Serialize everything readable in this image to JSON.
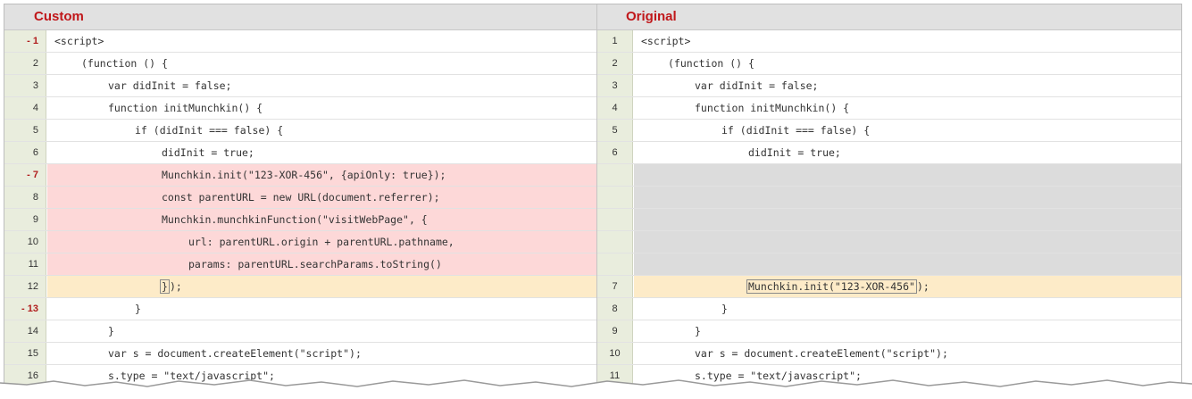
{
  "left_pane": {
    "title": "Custom",
    "lines": [
      {
        "num": "- 1",
        "indent": 0,
        "text": "<script>",
        "status": "changed-marker"
      },
      {
        "num": "2",
        "indent": 1,
        "text": "(function () {"
      },
      {
        "num": "3",
        "indent": 2,
        "text": "var didInit = false;"
      },
      {
        "num": "4",
        "indent": 2,
        "text": "function initMunchkin() {"
      },
      {
        "num": "5",
        "indent": 3,
        "text": "if (didInit === false) {"
      },
      {
        "num": "6",
        "indent": 4,
        "text": "didInit = true;"
      },
      {
        "num": "- 7",
        "indent": 4,
        "text": "Munchkin.init(\"123-XOR-456\", {apiOnly: true});",
        "status": "deleted",
        "marker": true
      },
      {
        "num": "8",
        "indent": 4,
        "text": "const parentURL = new URL(document.referrer);",
        "status": "deleted"
      },
      {
        "num": "9",
        "indent": 4,
        "text": "Munchkin.munchkinFunction(\"visitWebPage\", {",
        "status": "deleted"
      },
      {
        "num": "10",
        "indent": 5,
        "text": "url: parentURL.origin + parentURL.pathname,",
        "status": "deleted"
      },
      {
        "num": "11",
        "indent": 5,
        "text": "params: parentURL.searchParams.toString()",
        "status": "deleted"
      },
      {
        "num": "12",
        "indent": 4,
        "text_hl": "}",
        "text_after": ");",
        "status": "modified"
      },
      {
        "num": "- 13",
        "indent": 3,
        "text": "}",
        "status": "changed-marker"
      },
      {
        "num": "14",
        "indent": 2,
        "text": "}"
      },
      {
        "num": "15",
        "indent": 2,
        "text": "var s = document.createElement(\"script\");"
      },
      {
        "num": "16",
        "indent": 2,
        "text": "s.type = \"text/javascript\";"
      }
    ]
  },
  "right_pane": {
    "title": "Original",
    "lines": [
      {
        "num": "1",
        "indent": 0,
        "text": "<script>"
      },
      {
        "num": "2",
        "indent": 1,
        "text": "(function () {"
      },
      {
        "num": "3",
        "indent": 2,
        "text": "var didInit = false;"
      },
      {
        "num": "4",
        "indent": 2,
        "text": "function initMunchkin() {"
      },
      {
        "num": "5",
        "indent": 3,
        "text": "if (didInit === false) {"
      },
      {
        "num": "6",
        "indent": 4,
        "text": "didInit = true;"
      },
      {
        "num": "",
        "status": "empty"
      },
      {
        "num": "",
        "status": "empty"
      },
      {
        "num": "",
        "status": "empty"
      },
      {
        "num": "",
        "status": "empty"
      },
      {
        "num": "",
        "status": "empty"
      },
      {
        "num": "7",
        "indent": 4,
        "text_hl": "Munchkin.init(\"123-XOR-456\"",
        "text_after": ");",
        "status": "modified"
      },
      {
        "num": "8",
        "indent": 3,
        "text": "}"
      },
      {
        "num": "9",
        "indent": 2,
        "text": "}"
      },
      {
        "num": "10",
        "indent": 2,
        "text": "var s = document.createElement(\"script\");"
      },
      {
        "num": "11",
        "indent": 2,
        "text": "s.type = \"text/javascript\";"
      }
    ]
  },
  "colors": {
    "title_red": "#c0171a",
    "deleted_bg": "#fdd8d8",
    "modified_bg": "#fdebc8",
    "empty_bg": "#dcdcdc",
    "gutter_bg": "#e9eddd"
  }
}
